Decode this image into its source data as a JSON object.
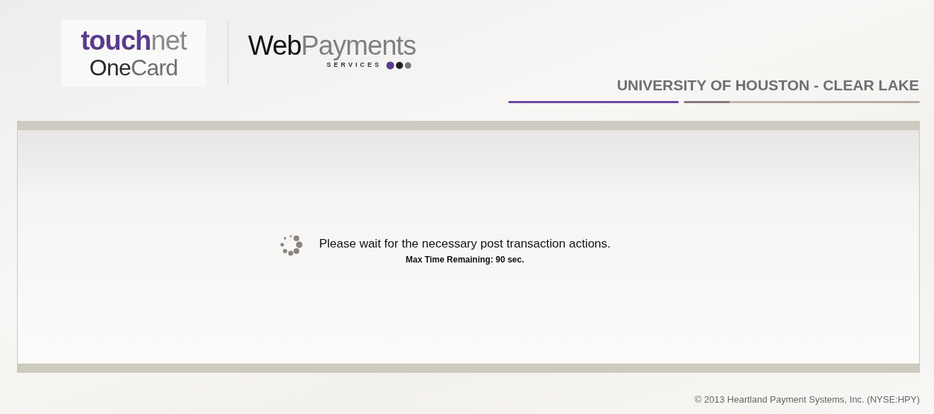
{
  "header": {
    "logo_primary": {
      "parts": [
        "touch",
        "net"
      ],
      "subtitle_parts": [
        "One",
        "Card"
      ]
    },
    "logo_secondary": {
      "parts": [
        "Web",
        "Payments"
      ],
      "tagline": "SERVICES"
    },
    "institution": "UNIVERSITY OF HOUSTON - CLEAR LAKE"
  },
  "panel": {
    "message": "Please wait for the necessary post transaction actions.",
    "timer": "Max Time Remaining: 90 sec."
  },
  "footer": "© 2013 Heartland Payment Systems, Inc. (NYSE:HPY)"
}
